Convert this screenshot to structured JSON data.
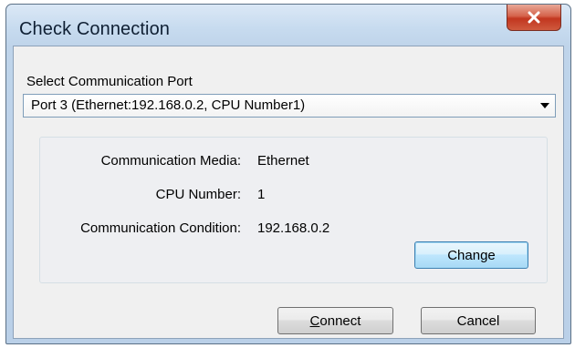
{
  "window": {
    "title": "Check Connection",
    "close_glyph": "X"
  },
  "port": {
    "label": "Select Communication Port",
    "selected": "Port 3 (Ethernet:192.168.0.2, CPU Number1)"
  },
  "info": {
    "media_label": "Communication Media:",
    "media_value": "Ethernet",
    "cpu_label": "CPU Number:",
    "cpu_value": "1",
    "condition_label": "Communication Condition:",
    "condition_value": "192.168.0.2"
  },
  "buttons": {
    "change": "Change",
    "connect_mnemonic": "C",
    "connect_rest": "onnect",
    "cancel": "Cancel"
  },
  "colors": {
    "title_bar": "#c7dbef",
    "close_button": "#c2361f",
    "dialog_face": "#f0f0f0",
    "default_button": "#a7d9f5"
  }
}
